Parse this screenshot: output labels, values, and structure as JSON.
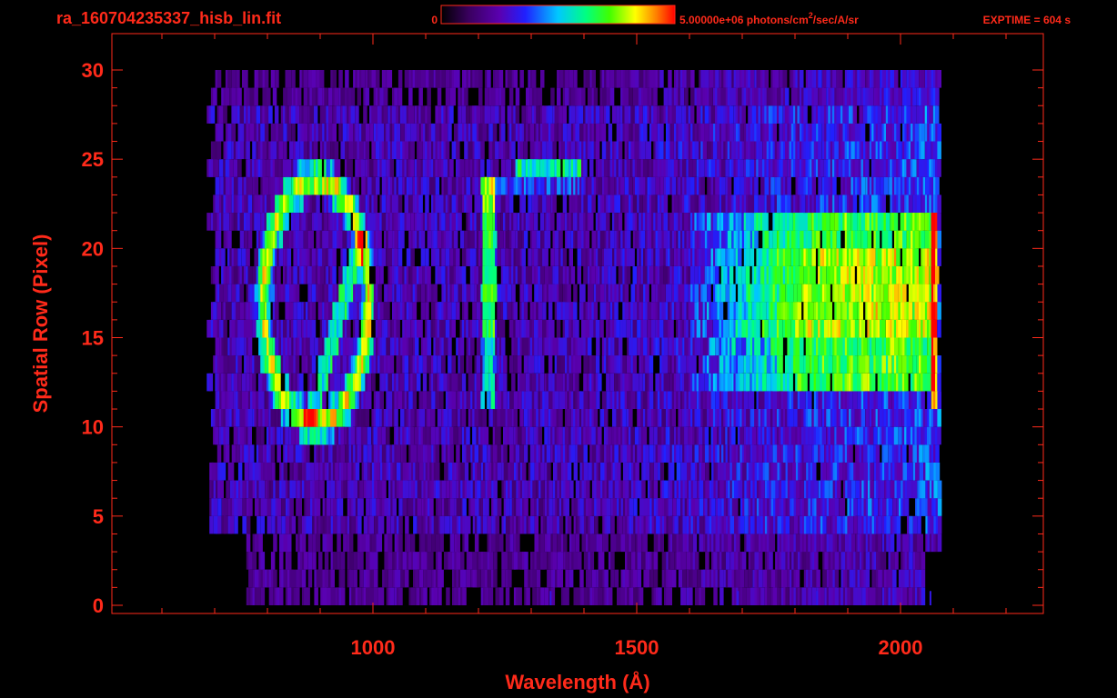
{
  "header": {
    "filename": "ra_160704235337_hisb_lin.fit",
    "colorbar_min": "0",
    "colorbar_max_value": "5.00000e+06 photons/cm",
    "colorbar_max_sup": "2",
    "colorbar_max_tail": "/sec/A/sr",
    "exptime": "EXPTIME = 604 s"
  },
  "colors": {
    "text": "#ff2a1a",
    "axis": "#ff2a1a",
    "background": "#000000",
    "colormap": [
      "#000000",
      "#3a0060",
      "#5a00b0",
      "#2020ff",
      "#00c8ff",
      "#00ff80",
      "#40ff00",
      "#ffff00",
      "#ff8000",
      "#ff0000"
    ]
  },
  "chart_data": {
    "type": "heatmap",
    "title": "ra_160704235337_hisb_lin.fit",
    "xlabel": "Wavelength (Å)",
    "ylabel": "Spatial Row (Pixel)",
    "xlim": [
      520,
      2300
    ],
    "ylim": [
      0,
      30
    ],
    "xticks": [
      1000,
      1500,
      2000
    ],
    "xtick_labels": [
      "1000",
      "1500",
      "2000"
    ],
    "yticks": [
      0,
      5,
      10,
      15,
      20,
      25,
      30
    ],
    "ytick_labels": [
      "0",
      "5",
      "10",
      "15",
      "20",
      "25",
      "30"
    ],
    "colorbar": {
      "min": 0,
      "max": 5000000,
      "units": "photons/cm^2/sec/A/sr",
      "colormap": "rainbow"
    },
    "data_extent": {
      "wavelength": [
        685,
        2090
      ],
      "rows": [
        0,
        30
      ]
    },
    "features": [
      {
        "name": "loop-arc",
        "wavelength_range": [
          790,
          1000
        ],
        "rows": [
          10,
          24
        ],
        "intensity": "high"
      },
      {
        "name": "line-1216",
        "wavelength": 1216,
        "rows": [
          11,
          24
        ],
        "intensity": "high"
      },
      {
        "name": "continuum",
        "wavelength_range": [
          1600,
          2060
        ],
        "rows": [
          12,
          22
        ],
        "intensity": "high"
      },
      {
        "name": "row-24-blob",
        "wavelength_range": [
          1270,
          1390
        ],
        "rows": [
          24,
          25
        ],
        "intensity": "medium"
      }
    ],
    "grid": false
  }
}
